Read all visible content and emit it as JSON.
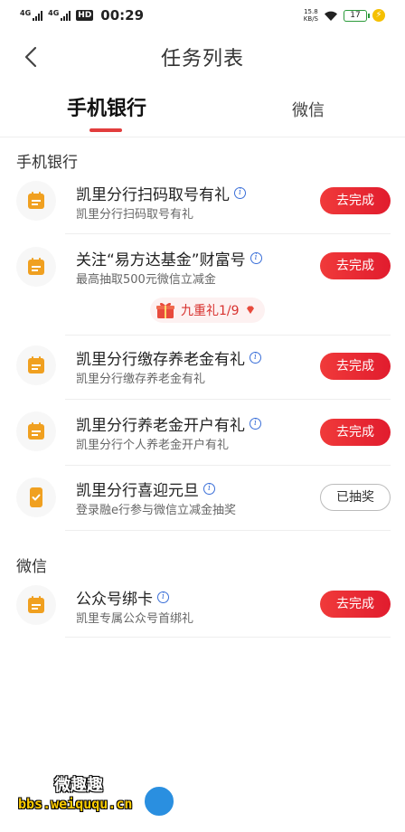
{
  "status_bar": {
    "signal_1": "4G",
    "signal_2": "4G",
    "hd": "HD",
    "time": "00:29",
    "speed_value": "15.8",
    "speed_unit": "KB/S",
    "battery": "17"
  },
  "nav": {
    "title": "任务列表",
    "back_icon": "chevron-left-icon"
  },
  "tabs": [
    {
      "label": "手机银行",
      "active": true
    },
    {
      "label": "微信",
      "active": false
    }
  ],
  "sections": {
    "mobile_bank": "手机银行",
    "wechat": "微信"
  },
  "tasks": [
    {
      "title": "凯里分行扫码取号有礼",
      "subtitle": "凯里分行扫码取号有礼",
      "button": "去完成",
      "icon": "document-icon"
    },
    {
      "title": "关注“易方达基金”财富号",
      "subtitle": "最高抽取500元微信立减金",
      "button": "去完成",
      "icon": "document-icon"
    },
    {
      "title": "凯里分行缴存养老金有礼",
      "subtitle": "凯里分行缴存养老金有礼",
      "button": "去完成",
      "icon": "document-icon"
    },
    {
      "title": "凯里分行养老金开户有礼",
      "subtitle": "凯里分行个人养老金开户有礼",
      "button": "去完成",
      "icon": "document-icon"
    },
    {
      "title": "凯里分行喜迎元旦",
      "subtitle": "登录融e行参与微信立减金抽奖",
      "button": "已抽奖",
      "icon": "phone-check-icon"
    },
    {
      "title": "公众号绑卡",
      "subtitle": "凯里专属公众号首绑礼",
      "button": "去完成",
      "icon": "document-icon"
    }
  ],
  "gift": {
    "label": "九重礼1/9",
    "icon": "gift-icon"
  },
  "watermark": {
    "line1": "微趣趣",
    "line2": "bbs.weiququ.cn"
  },
  "colors": {
    "accent": "#e11c2e",
    "icon_orange": "#f0a020",
    "info_blue": "#3a6fd8"
  }
}
